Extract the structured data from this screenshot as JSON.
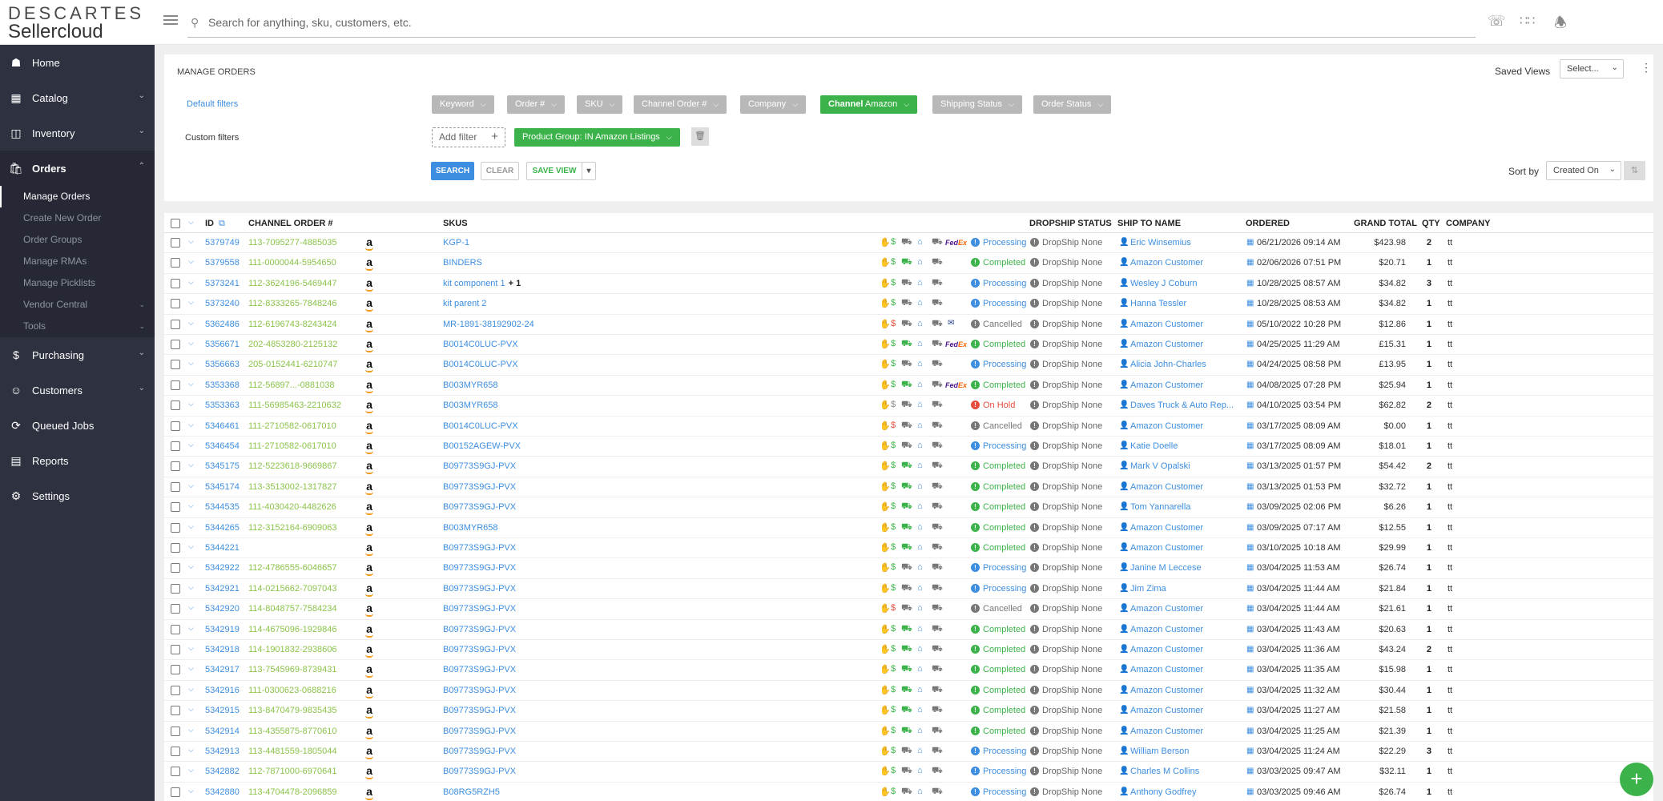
{
  "brand": {
    "line1": "DESCARTES",
    "line2": "Sellercloud"
  },
  "search": {
    "placeholder": "Search for anything, sku, customers, etc."
  },
  "sidebar": {
    "items": [
      {
        "label": "Home",
        "icon": "home-icon"
      },
      {
        "label": "Catalog",
        "icon": "catalog-icon"
      },
      {
        "label": "Inventory",
        "icon": "inventory-icon"
      },
      {
        "label": "Orders",
        "icon": "orders-icon"
      },
      {
        "label": "Purchasing",
        "icon": "purchasing-icon"
      },
      {
        "label": "Customers",
        "icon": "customers-icon"
      },
      {
        "label": "Queued Jobs",
        "icon": "queued-jobs-icon"
      },
      {
        "label": "Reports",
        "icon": "reports-icon"
      },
      {
        "label": "Settings",
        "icon": "settings-icon"
      }
    ],
    "orders_sub": [
      "Manage Orders",
      "Create New Order",
      "Order Groups",
      "Manage RMAs",
      "Manage Picklists",
      "Vendor Central",
      "Tools"
    ]
  },
  "page": {
    "title": "MANAGE ORDERS",
    "saved_views_label": "Saved Views",
    "saved_views_value": "Select...",
    "default_filters_label": "Default filters",
    "custom_filters_label": "Custom filters",
    "filters": [
      "Keyword",
      "Order #",
      "SKU",
      "Channel Order #",
      "Company",
      "Shipping Status",
      "Order Status"
    ],
    "channel_filter": {
      "key": "Channel",
      "value": "Amazon"
    },
    "add_filter": "Add filter",
    "custom_filter_chip": "Product Group: IN Amazon Listings",
    "search_btn": "SEARCH",
    "clear_btn": "CLEAR",
    "save_view_btn": "SAVE VIEW",
    "sort_by_label": "Sort by",
    "sort_by_value": "Created On"
  },
  "table": {
    "headers": {
      "id": "ID",
      "channel_order": "CHANNEL ORDER #",
      "skus": "SKUS",
      "dropship": "DROPSHIP STATUS",
      "ship_to": "SHIP TO NAME",
      "ordered": "ORDERED",
      "grand_total": "GRAND TOTAL",
      "qty": "QTY",
      "company": "COMPANY"
    },
    "colors": {
      "processing": "#3d8ee0",
      "completed": "#3cb34a",
      "cancelled": "#777777",
      "on_hold": "#e74c3c",
      "link": "#3d8ee0",
      "channel_order": "#8bc34a"
    },
    "rows": [
      {
        "id": "5379749",
        "channel_order": "113-7095277-4885035",
        "sku": "KGP-1",
        "sku_extra": "",
        "carrier": "FedEx",
        "status": "Processing",
        "dropship": "DropShip None",
        "ship_to": "Eric Winsemius",
        "ordered": "06/21/2026 09:14 AM",
        "total": "$423.98",
        "qty": "2",
        "company": "tt"
      },
      {
        "id": "5379558",
        "channel_order": "111-0000044-5954650",
        "sku": "BINDERS",
        "sku_extra": "",
        "carrier": "",
        "status": "Completed",
        "dropship": "DropShip None",
        "ship_to": "Amazon Customer",
        "ordered": "02/06/2026 07:51 PM",
        "total": "$20.71",
        "qty": "1",
        "company": "tt"
      },
      {
        "id": "5373241",
        "channel_order": "112-3624196-5469447",
        "sku": "kit component 1",
        "sku_extra": "+ 1",
        "carrier": "",
        "status": "Processing",
        "dropship": "DropShip None",
        "ship_to": "Wesley J Coburn",
        "ordered": "10/28/2025 08:57 AM",
        "total": "$34.82",
        "qty": "3",
        "company": "tt"
      },
      {
        "id": "5373240",
        "channel_order": "112-8333265-7848246",
        "sku": "kit parent 2",
        "sku_extra": "",
        "carrier": "",
        "status": "Processing",
        "dropship": "DropShip None",
        "ship_to": "Hanna Tessler",
        "ordered": "10/28/2025 08:53 AM",
        "total": "$34.82",
        "qty": "1",
        "company": "tt"
      },
      {
        "id": "5362486",
        "channel_order": "112-6196743-8243424",
        "sku": "MR-1891-38192902-24",
        "sku_extra": "",
        "carrier": "USPS",
        "status": "Cancelled",
        "dropship": "DropShip None",
        "ship_to": "Amazon Customer",
        "ordered": "05/10/2022 10:28 PM",
        "total": "$12.86",
        "qty": "1",
        "company": "tt"
      },
      {
        "id": "5356671",
        "channel_order": "202-4853280-2125132",
        "sku": "B0014C0LUC-PVX",
        "sku_extra": "",
        "carrier": "FedEx",
        "status": "Completed",
        "dropship": "DropShip None",
        "ship_to": "Amazon Customer",
        "ordered": "04/25/2025 11:29 AM",
        "total": "£15.31",
        "qty": "1",
        "company": "tt"
      },
      {
        "id": "5356663",
        "channel_order": "205-0152441-6210747",
        "sku": "B0014C0LUC-PVX",
        "sku_extra": "",
        "carrier": "",
        "status": "Processing",
        "dropship": "DropShip None",
        "ship_to": "Alicia John-Charles",
        "ordered": "04/24/2025 08:58 PM",
        "total": "£13.95",
        "qty": "1",
        "company": "tt"
      },
      {
        "id": "5353368",
        "channel_order": "112-56897...-0881038",
        "sku": "B003MYR658",
        "sku_extra": "",
        "carrier": "FedEx",
        "status": "Completed",
        "dropship": "DropShip None",
        "ship_to": "Amazon Customer",
        "ordered": "04/08/2025 07:28 PM",
        "total": "$25.94",
        "qty": "1",
        "company": "tt"
      },
      {
        "id": "5353363",
        "channel_order": "111-56985463-2210632",
        "sku": "B003MYR658",
        "sku_extra": "",
        "carrier": "",
        "status": "On Hold",
        "dropship": "DropShip None",
        "ship_to": "Daves Truck & Auto Rep...",
        "ordered": "04/10/2025 03:54 PM",
        "total": "$62.82",
        "qty": "2",
        "company": "tt"
      },
      {
        "id": "5346461",
        "channel_order": "111-2710582-0617010",
        "sku": "B0014C0LUC-PVX",
        "sku_extra": "",
        "carrier": "",
        "status": "Cancelled",
        "dropship": "DropShip None",
        "ship_to": "Amazon Customer",
        "ordered": "03/17/2025 08:09 AM",
        "total": "$0.00",
        "qty": "1",
        "company": "tt"
      },
      {
        "id": "5346454",
        "channel_order": "111-2710582-0617010",
        "sku": "B00152AGEW-PVX",
        "sku_extra": "",
        "carrier": "",
        "status": "Processing",
        "dropship": "DropShip None",
        "ship_to": "Katie Doelle",
        "ordered": "03/17/2025 08:09 AM",
        "total": "$18.01",
        "qty": "1",
        "company": "tt"
      },
      {
        "id": "5345175",
        "channel_order": "112-5223618-9669867",
        "sku": "B09773S9GJ-PVX",
        "sku_extra": "",
        "carrier": "",
        "status": "Completed",
        "dropship": "DropShip None",
        "ship_to": "Mark V Opalski",
        "ordered": "03/13/2025 01:57 PM",
        "total": "$54.42",
        "qty": "2",
        "company": "tt"
      },
      {
        "id": "5345174",
        "channel_order": "113-3513002-1317827",
        "sku": "B09773S9GJ-PVX",
        "sku_extra": "",
        "carrier": "",
        "status": "Completed",
        "dropship": "DropShip None",
        "ship_to": "Amazon Customer",
        "ordered": "03/13/2025 01:53 PM",
        "total": "$32.72",
        "qty": "1",
        "company": "tt"
      },
      {
        "id": "5344535",
        "channel_order": "111-4030420-4482626",
        "sku": "B09773S9GJ-PVX",
        "sku_extra": "",
        "carrier": "",
        "status": "Completed",
        "dropship": "DropShip None",
        "ship_to": "Tom Yannarella",
        "ordered": "03/09/2025 02:06 PM",
        "total": "$6.26",
        "qty": "1",
        "company": "tt"
      },
      {
        "id": "5344265",
        "channel_order": "112-3152164-6909063",
        "sku": "B003MYR658",
        "sku_extra": "",
        "carrier": "",
        "status": "Completed",
        "dropship": "DropShip None",
        "ship_to": "Amazon Customer",
        "ordered": "03/09/2025 07:17 AM",
        "total": "$12.55",
        "qty": "1",
        "company": "tt"
      },
      {
        "id": "5344221",
        "channel_order": "",
        "sku": "B09773S9GJ-PVX",
        "sku_extra": "",
        "carrier": "",
        "status": "Completed",
        "dropship": "DropShip None",
        "ship_to": "Amazon Customer",
        "ordered": "03/10/2025 10:18 AM",
        "total": "$29.99",
        "qty": "1",
        "company": "tt"
      },
      {
        "id": "5342922",
        "channel_order": "112-4786555-6046657",
        "sku": "B09773S9GJ-PVX",
        "sku_extra": "",
        "carrier": "",
        "status": "Processing",
        "dropship": "DropShip None",
        "ship_to": "Janine M Leccese",
        "ordered": "03/04/2025 11:53 AM",
        "total": "$26.74",
        "qty": "1",
        "company": "tt"
      },
      {
        "id": "5342921",
        "channel_order": "114-0215662-7097043",
        "sku": "B09773S9GJ-PVX",
        "sku_extra": "",
        "carrier": "",
        "status": "Processing",
        "dropship": "DropShip None",
        "ship_to": "Jim Zima",
        "ordered": "03/04/2025 11:44 AM",
        "total": "$21.84",
        "qty": "1",
        "company": "tt"
      },
      {
        "id": "5342920",
        "channel_order": "114-8048757-7584234",
        "sku": "B09773S9GJ-PVX",
        "sku_extra": "",
        "carrier": "",
        "status": "Cancelled",
        "dropship": "DropShip None",
        "ship_to": "Amazon Customer",
        "ordered": "03/04/2025 11:44 AM",
        "total": "$21.61",
        "qty": "1",
        "company": "tt"
      },
      {
        "id": "5342919",
        "channel_order": "114-4675096-1929846",
        "sku": "B09773S9GJ-PVX",
        "sku_extra": "",
        "carrier": "",
        "status": "Completed",
        "dropship": "DropShip None",
        "ship_to": "Amazon Customer",
        "ordered": "03/04/2025 11:43 AM",
        "total": "$20.63",
        "qty": "1",
        "company": "tt"
      },
      {
        "id": "5342918",
        "channel_order": "114-1901832-2938606",
        "sku": "B09773S9GJ-PVX",
        "sku_extra": "",
        "carrier": "",
        "status": "Completed",
        "dropship": "DropShip None",
        "ship_to": "Amazon Customer",
        "ordered": "03/04/2025 11:36 AM",
        "total": "$43.24",
        "qty": "2",
        "company": "tt"
      },
      {
        "id": "5342917",
        "channel_order": "113-7545969-8739431",
        "sku": "B09773S9GJ-PVX",
        "sku_extra": "",
        "carrier": "",
        "status": "Completed",
        "dropship": "DropShip None",
        "ship_to": "Amazon Customer",
        "ordered": "03/04/2025 11:35 AM",
        "total": "$15.98",
        "qty": "1",
        "company": "tt"
      },
      {
        "id": "5342916",
        "channel_order": "111-0300623-0688216",
        "sku": "B09773S9GJ-PVX",
        "sku_extra": "",
        "carrier": "",
        "status": "Completed",
        "dropship": "DropShip None",
        "ship_to": "Amazon Customer",
        "ordered": "03/04/2025 11:32 AM",
        "total": "$30.44",
        "qty": "1",
        "company": "tt"
      },
      {
        "id": "5342915",
        "channel_order": "113-8470479-9835435",
        "sku": "B09773S9GJ-PVX",
        "sku_extra": "",
        "carrier": "",
        "status": "Completed",
        "dropship": "DropShip None",
        "ship_to": "Amazon Customer",
        "ordered": "03/04/2025 11:27 AM",
        "total": "$21.58",
        "qty": "1",
        "company": "tt"
      },
      {
        "id": "5342914",
        "channel_order": "113-4355875-8770610",
        "sku": "B09773S9GJ-PVX",
        "sku_extra": "",
        "carrier": "",
        "status": "Completed",
        "dropship": "DropShip None",
        "ship_to": "Amazon Customer",
        "ordered": "03/04/2025 11:25 AM",
        "total": "$21.39",
        "qty": "1",
        "company": "tt"
      },
      {
        "id": "5342913",
        "channel_order": "113-4481559-1805044",
        "sku": "B09773S9GJ-PVX",
        "sku_extra": "",
        "carrier": "",
        "status": "Processing",
        "dropship": "DropShip None",
        "ship_to": "William Berson",
        "ordered": "03/04/2025 11:24 AM",
        "total": "$22.29",
        "qty": "3",
        "company": "tt"
      },
      {
        "id": "5342882",
        "channel_order": "112-7871000-6970641",
        "sku": "B09773S9GJ-PVX",
        "sku_extra": "",
        "carrier": "",
        "status": "Processing",
        "dropship": "DropShip None",
        "ship_to": "Charles M Collins",
        "ordered": "03/03/2025 09:47 AM",
        "total": "$32.11",
        "qty": "1",
        "company": "tt"
      },
      {
        "id": "5342880",
        "channel_order": "113-4704478-2096859",
        "sku": "B08RG5RZH5",
        "sku_extra": "",
        "carrier": "",
        "status": "Processing",
        "dropship": "DropShip None",
        "ship_to": "Anthony Godfrey",
        "ordered": "03/03/2025 09:46 AM",
        "total": "$26.74",
        "qty": "1",
        "company": "tt"
      }
    ]
  }
}
